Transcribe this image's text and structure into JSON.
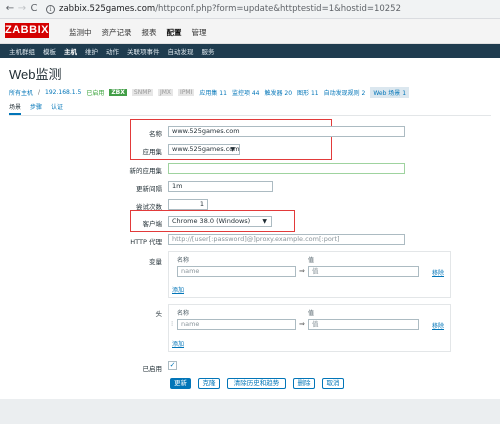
{
  "browser": {
    "back": "←",
    "forward": "→",
    "reload": "C",
    "info": "i",
    "url_host": "zabbix.525games.com",
    "url_path": "/httpconf.php?form=update&httptestid=1&hostid=10252"
  },
  "header": {
    "logo": "ZABBIX",
    "menu": [
      "监测中",
      "资产记录",
      "报表",
      "配置",
      "管理"
    ],
    "active_menu": "配置"
  },
  "subnav": {
    "items": [
      "主机群组",
      "模板",
      "主机",
      "维护",
      "动作",
      "关联项事件",
      "自动发现",
      "服务"
    ],
    "active": "主机"
  },
  "page": {
    "title": "Web监测"
  },
  "breadcrumb": {
    "all_hosts": "所有主机",
    "sep": "/",
    "host": "192.168.1.5",
    "enabled": "已启用",
    "zbx": "ZBX",
    "snmp": "SNMP",
    "jmx": "JMX",
    "ipmi": "IPMI",
    "apps": "应用集 11",
    "items": "监控项 44",
    "triggers": "触发器 20",
    "graphs": "图形 11",
    "discovery": "自动发现规则 2",
    "web": "Web 场景 1"
  },
  "tabs": [
    "场景",
    "步骤",
    "认证"
  ],
  "active_tab": "场景",
  "form": {
    "name_label": "名称",
    "name_value": "www.525games.com",
    "app_label": "应用集",
    "app_value": "www.525games.com",
    "new_app_label": "新的应用集",
    "new_app_value": "",
    "interval_label": "更新间隔",
    "interval_value": "1m",
    "attempts_label": "尝试次数",
    "attempts_value": "1",
    "agent_label": "客户端",
    "agent_value": "Chrome 38.0 (Windows)",
    "proxy_label": "HTTP 代理",
    "proxy_placeholder": "http://[user[:password]@]proxy.example.com[:port]",
    "variables_label": "变量",
    "headers_label": "头",
    "col_name": "名称",
    "col_value": "值",
    "name_placeholder": "name",
    "value_placeholder": "值",
    "arrow": "⇒",
    "remove": "移除",
    "add": "添加",
    "enabled_label": "已启用",
    "enabled_check": "✓"
  },
  "buttons": {
    "update": "更新",
    "clone": "克隆",
    "clear": "清除历史和趋势",
    "delete": "删除",
    "cancel": "取消"
  },
  "colors": {
    "accent": "#0275b8",
    "brand": "#d40000",
    "highlight": "#e23a3a"
  }
}
